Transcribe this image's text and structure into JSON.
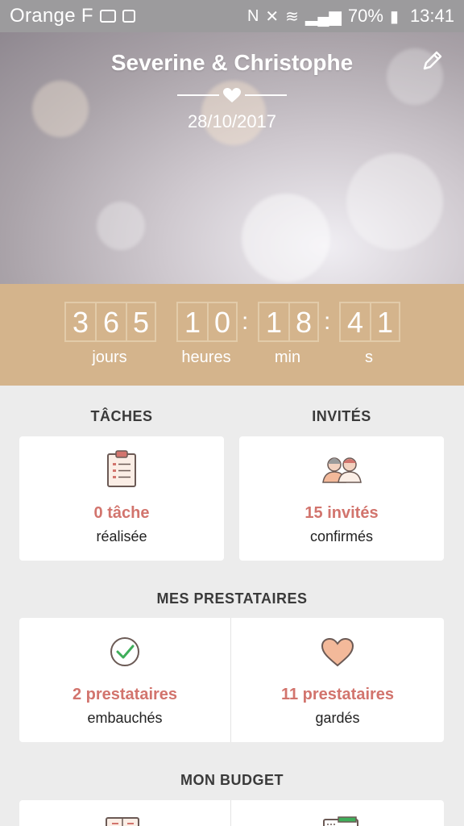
{
  "status_bar": {
    "carrier": "Orange F",
    "battery": "70%",
    "time": "13:41"
  },
  "hero": {
    "couple": "Severine & Christophe",
    "date": "28/10/2017"
  },
  "countdown": {
    "days": [
      "3",
      "6",
      "5"
    ],
    "hours": [
      "1",
      "0"
    ],
    "minutes": [
      "1",
      "8"
    ],
    "seconds": [
      "4",
      "1"
    ],
    "labels": {
      "days": "jours",
      "hours": "heures",
      "minutes": "min",
      "seconds": "s"
    }
  },
  "sections": {
    "tasks": {
      "title": "TÂCHES",
      "count": "0 tâche",
      "caption": "réalisée"
    },
    "guests": {
      "title": "INVITÉS",
      "count": "15 invités",
      "caption": "confirmés"
    },
    "vendors": {
      "title": "MES PRESTATAIRES",
      "hired": {
        "count": "2 prestataires",
        "caption": "embauchés"
      },
      "saved": {
        "count": "11 prestataires",
        "caption": "gardés"
      }
    },
    "budget": {
      "title": "MON BUDGET"
    }
  },
  "colors": {
    "accent": "#d2746d",
    "countdown_bg": "#d4b48c",
    "check_green": "#3fae5a",
    "heart_fill": "#f3b99a"
  }
}
